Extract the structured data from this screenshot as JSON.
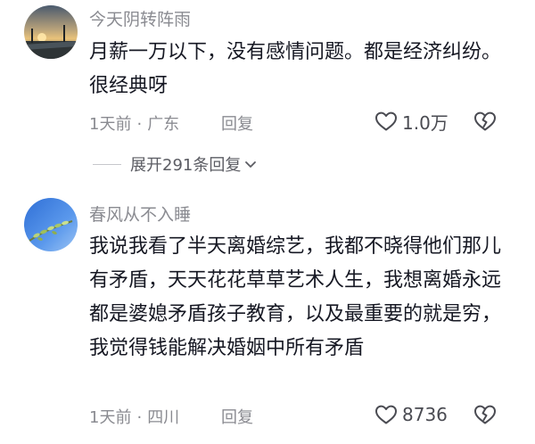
{
  "comments": [
    {
      "username": "今天阴转阵雨",
      "text": "月薪一万以下，没有感情问题。都是经济纠纷。很经典呀",
      "time": "1天前",
      "location": "广东",
      "reply_label": "回复",
      "like_count": "1.0万",
      "expand_label": "展开291条回复"
    },
    {
      "username": "春风从不入睡",
      "text": "我说我看了半天离婚综艺，我都不晓得他们那儿有矛盾，天天花花草草艺术人生，我想离婚永远都是婆媳矛盾孩子教育，以及最重要的就是穷，我觉得钱能解决婚姻中所有矛盾",
      "time": "1天前",
      "location": "四川",
      "reply_label": "回复",
      "like_count": "8736"
    }
  ],
  "meta_separator": "·",
  "icons": {
    "like": "heart-outline-icon",
    "dislike": "broken-heart-icon",
    "expand": "chevron-down-icon"
  },
  "colors": {
    "text_primary": "#161823",
    "text_secondary": "#8a8b91",
    "icon": "#4a4b52"
  }
}
